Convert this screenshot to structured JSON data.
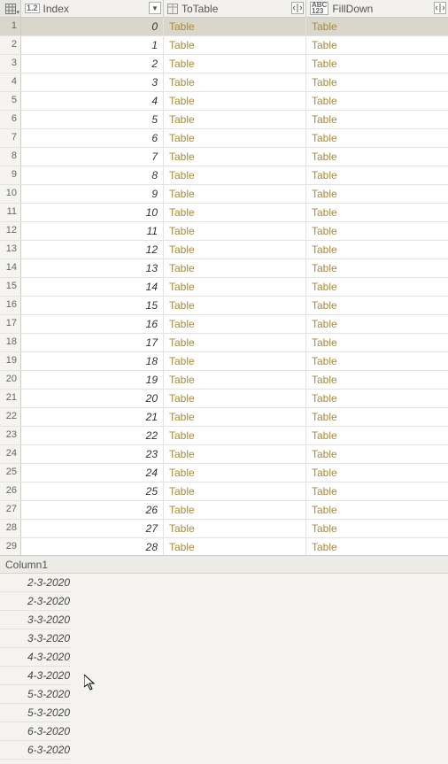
{
  "columns": {
    "index": {
      "type_badge": "1.2",
      "name": "Index"
    },
    "totable": {
      "type_badge": "",
      "name": "ToTable"
    },
    "filldown": {
      "type_badge": "ABC\n123",
      "name": "FillDown"
    }
  },
  "rows": [
    {
      "n": "1",
      "index": "0",
      "totable": "Table",
      "filldown": "Table",
      "selected": true
    },
    {
      "n": "2",
      "index": "1",
      "totable": "Table",
      "filldown": "Table"
    },
    {
      "n": "3",
      "index": "2",
      "totable": "Table",
      "filldown": "Table"
    },
    {
      "n": "4",
      "index": "3",
      "totable": "Table",
      "filldown": "Table"
    },
    {
      "n": "5",
      "index": "4",
      "totable": "Table",
      "filldown": "Table"
    },
    {
      "n": "6",
      "index": "5",
      "totable": "Table",
      "filldown": "Table"
    },
    {
      "n": "7",
      "index": "6",
      "totable": "Table",
      "filldown": "Table"
    },
    {
      "n": "8",
      "index": "7",
      "totable": "Table",
      "filldown": "Table"
    },
    {
      "n": "9",
      "index": "8",
      "totable": "Table",
      "filldown": "Table"
    },
    {
      "n": "10",
      "index": "9",
      "totable": "Table",
      "filldown": "Table"
    },
    {
      "n": "11",
      "index": "10",
      "totable": "Table",
      "filldown": "Table"
    },
    {
      "n": "12",
      "index": "11",
      "totable": "Table",
      "filldown": "Table"
    },
    {
      "n": "13",
      "index": "12",
      "totable": "Table",
      "filldown": "Table"
    },
    {
      "n": "14",
      "index": "13",
      "totable": "Table",
      "filldown": "Table"
    },
    {
      "n": "15",
      "index": "14",
      "totable": "Table",
      "filldown": "Table"
    },
    {
      "n": "16",
      "index": "15",
      "totable": "Table",
      "filldown": "Table"
    },
    {
      "n": "17",
      "index": "16",
      "totable": "Table",
      "filldown": "Table"
    },
    {
      "n": "18",
      "index": "17",
      "totable": "Table",
      "filldown": "Table"
    },
    {
      "n": "19",
      "index": "18",
      "totable": "Table",
      "filldown": "Table"
    },
    {
      "n": "20",
      "index": "19",
      "totable": "Table",
      "filldown": "Table"
    },
    {
      "n": "21",
      "index": "20",
      "totable": "Table",
      "filldown": "Table"
    },
    {
      "n": "22",
      "index": "21",
      "totable": "Table",
      "filldown": "Table"
    },
    {
      "n": "23",
      "index": "22",
      "totable": "Table",
      "filldown": "Table"
    },
    {
      "n": "24",
      "index": "23",
      "totable": "Table",
      "filldown": "Table"
    },
    {
      "n": "25",
      "index": "24",
      "totable": "Table",
      "filldown": "Table"
    },
    {
      "n": "26",
      "index": "25",
      "totable": "Table",
      "filldown": "Table"
    },
    {
      "n": "27",
      "index": "26",
      "totable": "Table",
      "filldown": "Table"
    },
    {
      "n": "28",
      "index": "27",
      "totable": "Table",
      "filldown": "Table"
    },
    {
      "n": "29",
      "index": "28",
      "totable": "Table",
      "filldown": "Table"
    }
  ],
  "preview": {
    "header": "Column1",
    "values": [
      "2-3-2020",
      "2-3-2020",
      "3-3-2020",
      "3-3-2020",
      "4-3-2020",
      "4-3-2020",
      "5-3-2020",
      "5-3-2020",
      "6-3-2020",
      "6-3-2020"
    ]
  }
}
